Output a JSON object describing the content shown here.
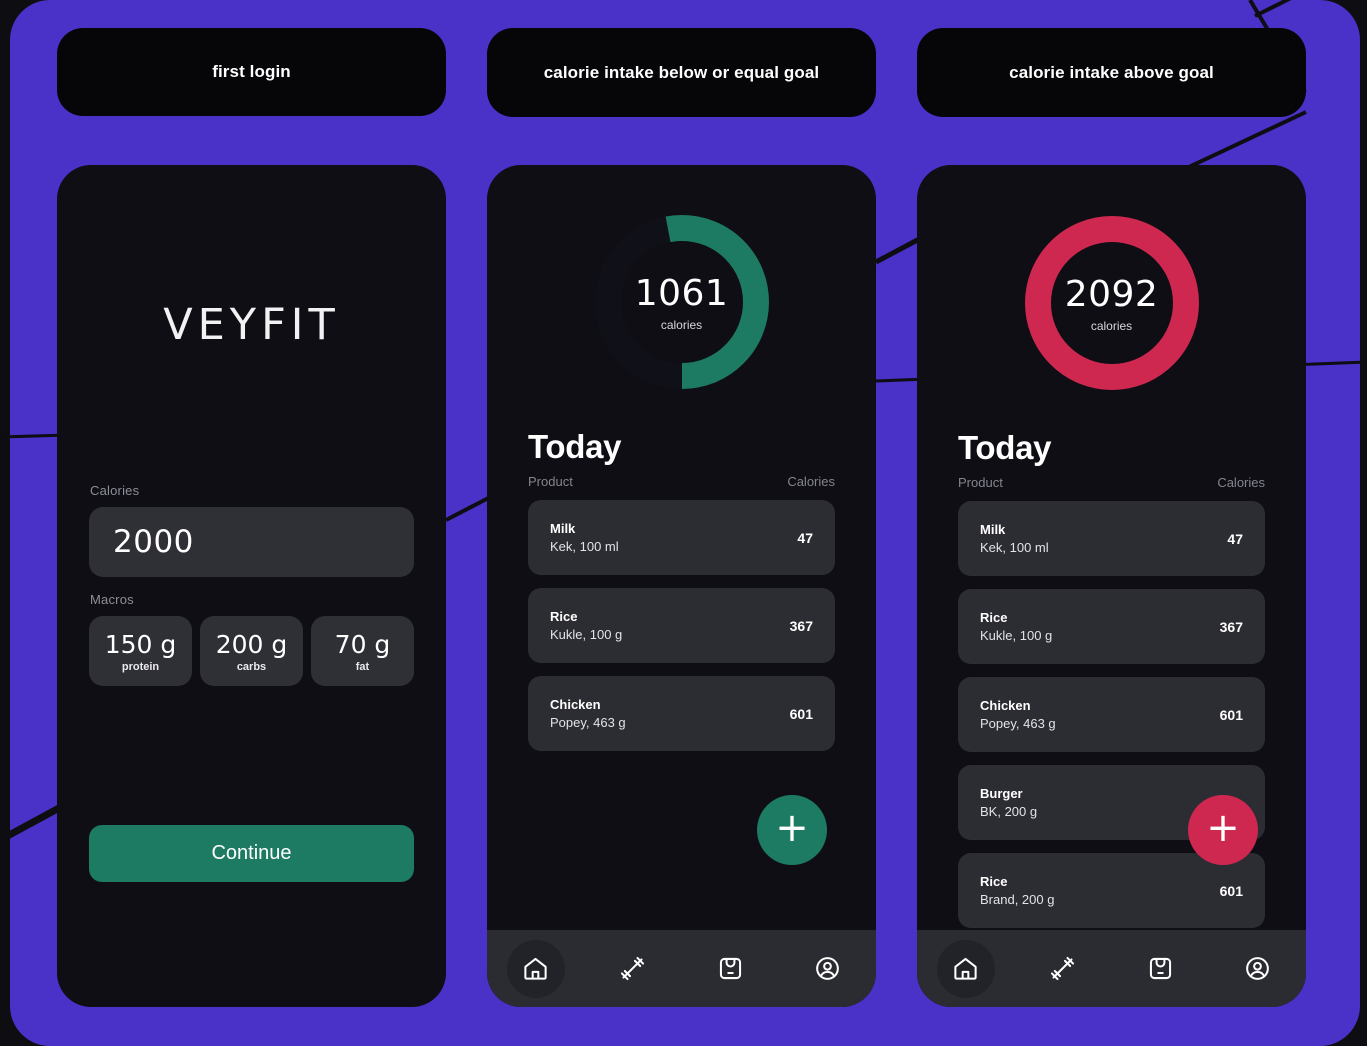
{
  "theme": {
    "canvas_purple": "#4a32c8",
    "panel_dark": "#0e0e14",
    "chip_black": "#060608",
    "accent_green": "#1d7a63",
    "accent_red": "#cf2850",
    "card_gray": "#2c2c33"
  },
  "chips": [
    {
      "label": "first login"
    },
    {
      "label": "calorie intake below or equal goal"
    },
    {
      "label": "calorie intake above goal"
    }
  ],
  "screen_onboarding": {
    "logo": "VEYFIT",
    "calories_label": "Calories",
    "calories_value": "2000",
    "calories_placeholder": "2000",
    "macros_label": "Macros",
    "macros": [
      {
        "value": "150 g",
        "name": "protein"
      },
      {
        "value": "200 g",
        "name": "carbs"
      },
      {
        "value": "70 g",
        "name": "fat"
      }
    ],
    "continue_label": "Continue"
  },
  "screen_under_goal": {
    "ring": {
      "value": "1061",
      "unit": "calories",
      "percent": 53,
      "color": "#1d7a63"
    },
    "section_title": "Today",
    "columns": {
      "product": "Product",
      "calories": "Calories"
    },
    "items": [
      {
        "name": "Milk",
        "desc": "Kek, 100 ml",
        "calories": "47"
      },
      {
        "name": "Rice",
        "desc": "Kukle, 100 g",
        "calories": "367"
      },
      {
        "name": "Chicken",
        "desc": "Popey, 463 g",
        "calories": "601"
      }
    ],
    "fab_label": "+",
    "nav": [
      {
        "icon": "home-icon",
        "active": true
      },
      {
        "icon": "dumbbell-icon",
        "active": false
      },
      {
        "icon": "scale-icon",
        "active": false
      },
      {
        "icon": "profile-icon",
        "active": false
      }
    ]
  },
  "screen_over_goal": {
    "ring": {
      "value": "2092",
      "unit": "calories",
      "percent": 100,
      "color": "#cf2850"
    },
    "section_title": "Today",
    "columns": {
      "product": "Product",
      "calories": "Calories"
    },
    "items": [
      {
        "name": "Milk",
        "desc": "Kek, 100 ml",
        "calories": "47"
      },
      {
        "name": "Rice",
        "desc": "Kukle, 100 g",
        "calories": "367"
      },
      {
        "name": "Chicken",
        "desc": "Popey, 463 g",
        "calories": "601"
      },
      {
        "name": "Burger",
        "desc": "BK, 200 g",
        "calories": ""
      },
      {
        "name": "Rice",
        "desc": "Brand, 200 g",
        "calories": "601"
      }
    ],
    "fab_label": "+",
    "nav": [
      {
        "icon": "home-icon",
        "active": true
      },
      {
        "icon": "dumbbell-icon",
        "active": false
      },
      {
        "icon": "scale-icon",
        "active": false
      },
      {
        "icon": "profile-icon",
        "active": false
      }
    ]
  }
}
